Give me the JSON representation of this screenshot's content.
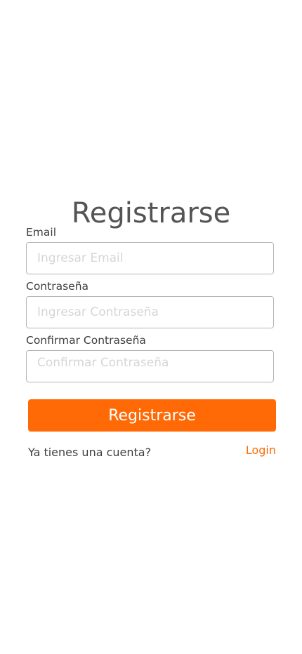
{
  "page": {
    "title": "Registrarse"
  },
  "form": {
    "email": {
      "label": "Email",
      "placeholder": "Ingresar Email",
      "value": ""
    },
    "password": {
      "label": "Contraseña",
      "placeholder": "Ingresar Contraseña",
      "value": ""
    },
    "confirm_password": {
      "label": "Confirmar Contraseña",
      "placeholder": "Confirmar Contraseña",
      "value": ""
    },
    "submit_label": "Registrarse"
  },
  "footer": {
    "prompt": "Ya tienes una cuenta?",
    "login_link": "Login"
  },
  "colors": {
    "accent": "#ff6a06",
    "title": "#545454",
    "label": "#3f3f3f",
    "border": "#b4b4b4",
    "placeholder": "#d6d6d6"
  }
}
